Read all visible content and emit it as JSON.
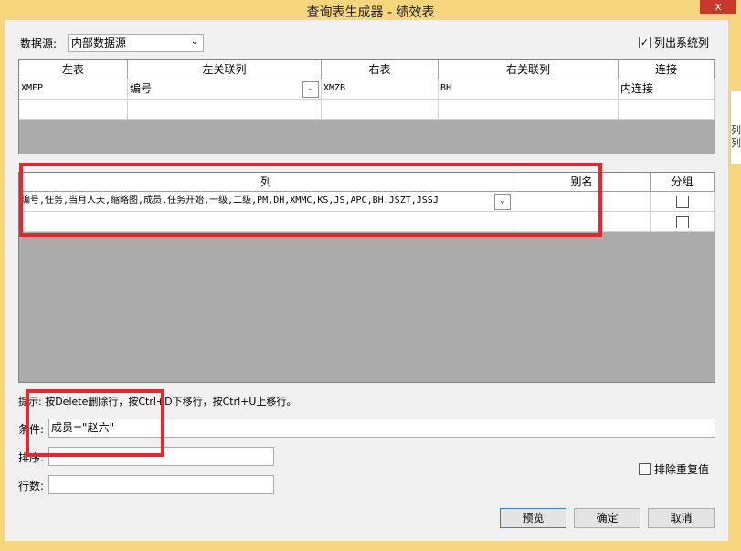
{
  "window": {
    "title": "查询表生成器 - 绩效表",
    "close_label": "x"
  },
  "datasource": {
    "label": "数据源:",
    "value": "内部数据源"
  },
  "list_system_columns": {
    "label": "列出系统列",
    "checked": true
  },
  "join_grid": {
    "headers": [
      "左表",
      "左关联列",
      "右表",
      "右关联列",
      "连接"
    ],
    "rows": [
      [
        "XMFP",
        "编号",
        "XMZB",
        "BH",
        "内连接"
      ],
      [
        "",
        "",
        "",
        "",
        ""
      ]
    ]
  },
  "column_grid": {
    "headers": [
      "列",
      "别名",
      "分组"
    ],
    "rows": [
      {
        "column": "编号,任务,当月人天,缩略图,成员,任务开始,一级,二级,PM,DH,XMMC,KS,JS,APC,BH,JSZT,JSSJ",
        "alias": "",
        "group": false
      },
      {
        "column": "",
        "alias": "",
        "group": false
      }
    ]
  },
  "hint": "提示: 按Delete删除行，按Ctrl+D下移行，按Ctrl+U上移行。",
  "condition": {
    "label": "条件:",
    "value": "成员=\"赵六\""
  },
  "sort": {
    "label": "排序:",
    "value": ""
  },
  "rowcount": {
    "label": "行数:",
    "value": ""
  },
  "exclude_duplicates": {
    "label": "排除重复值",
    "checked": false
  },
  "buttons": {
    "preview": "预览",
    "ok": "确定",
    "cancel": "取消"
  },
  "right_edge_text": "列\n列",
  "colors": {
    "frame": "#f6d67c",
    "close": "#c7392b",
    "highlight": "#e8262d",
    "grid_empty": "#ababab"
  }
}
